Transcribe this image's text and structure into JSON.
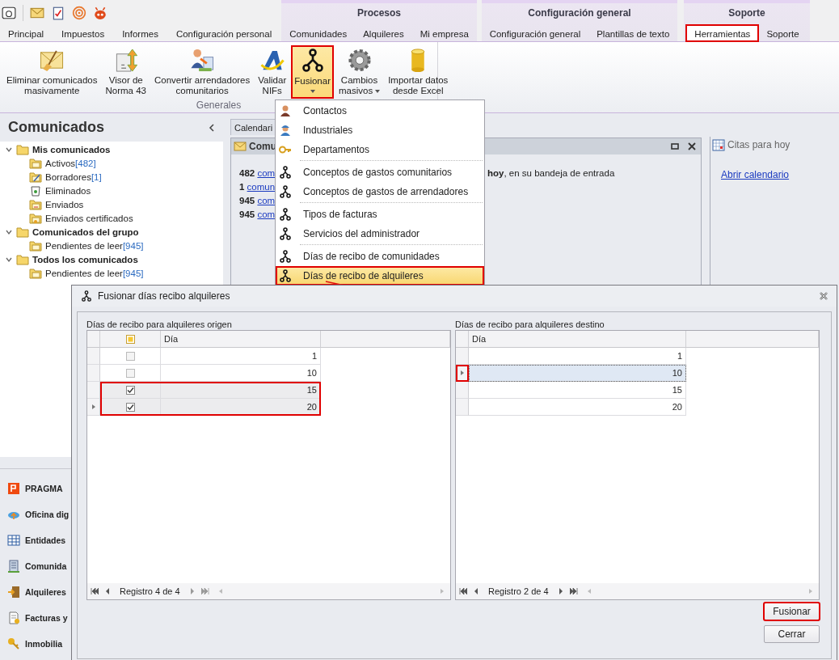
{
  "tabs": [
    {
      "label": "Principal",
      "selected": false,
      "highlighted": false
    },
    {
      "label": "Impuestos",
      "selected": false,
      "highlighted": false
    },
    {
      "label": "Informes",
      "selected": false,
      "highlighted": false
    },
    {
      "label": "Configuración personal",
      "selected": false,
      "highlighted": false
    }
  ],
  "tab_groups": [
    {
      "title": "Procesos",
      "tabs": [
        {
          "label": "Comunidades",
          "selected": false,
          "highlighted": false
        },
        {
          "label": "Alquileres",
          "selected": false,
          "highlighted": false
        },
        {
          "label": "Mi empresa",
          "selected": false,
          "highlighted": false
        }
      ]
    },
    {
      "title": "Configuración general",
      "tabs": [
        {
          "label": "Configuración general",
          "selected": false,
          "highlighted": false
        },
        {
          "label": "Plantillas de texto",
          "selected": false,
          "highlighted": false
        }
      ]
    },
    {
      "title": "Soporte",
      "tabs": [
        {
          "label": "Herramientas",
          "selected": true,
          "highlighted": true
        },
        {
          "label": "Soporte",
          "selected": false,
          "highlighted": false
        }
      ]
    }
  ],
  "ribbon": {
    "group_label": "Generales",
    "buttons": [
      {
        "lines": [
          "Eliminar comunicados",
          "masivamente"
        ],
        "dropdown": false,
        "highlighted": false
      },
      {
        "lines": [
          "Visor de",
          "Norma 43"
        ],
        "dropdown": false,
        "highlighted": false
      },
      {
        "lines": [
          "Convertir arrendadores",
          "comunitarios"
        ],
        "dropdown": false,
        "highlighted": false
      },
      {
        "lines": [
          "Validar",
          "NIFs"
        ],
        "dropdown": false,
        "highlighted": false
      },
      {
        "lines": [
          "Fusionar"
        ],
        "dropdown": true,
        "highlighted": true
      },
      {
        "lines": [
          "Cambios",
          "masivos"
        ],
        "dropdown": true,
        "highlighted": false
      },
      {
        "lines": [
          "Importar datos",
          "desde Excel"
        ],
        "dropdown": false,
        "highlighted": false
      }
    ]
  },
  "fusionar_menu": {
    "sections": [
      {
        "items": [
          {
            "label": "Contactos",
            "highlighted": false
          },
          {
            "label": "Industriales",
            "highlighted": false
          },
          {
            "label": "Departamentos",
            "highlighted": false
          }
        ]
      },
      {
        "items": [
          {
            "label": "Conceptos de gastos comunitarios",
            "highlighted": false
          },
          {
            "label": "Conceptos de gastos de arrendadores",
            "highlighted": false
          }
        ]
      },
      {
        "items": [
          {
            "label": "Tipos de facturas",
            "highlighted": false
          },
          {
            "label": "Servicios del administrador",
            "highlighted": false
          }
        ]
      },
      {
        "items": [
          {
            "label": "Días de recibo de comunidades",
            "highlighted": false
          },
          {
            "label": "Días de recibo de alquileres",
            "highlighted": true
          }
        ]
      }
    ]
  },
  "left_panel": {
    "title": "Comunicados",
    "tree": [
      {
        "label": "Mis comunicados",
        "expanded": true,
        "children": [
          {
            "label": "Activos",
            "count": "[482]"
          },
          {
            "label": "Borradores",
            "count": "[1]"
          },
          {
            "label": "Eliminados"
          },
          {
            "label": "Enviados"
          },
          {
            "label": "Enviados certificados"
          }
        ]
      },
      {
        "label": "Comunicados del grupo",
        "expanded": true,
        "children": [
          {
            "label": "Pendientes de leer",
            "count": "[945]"
          }
        ]
      },
      {
        "label": "Todos los comunicados",
        "expanded": true,
        "children": [
          {
            "label": "Pendientes de leer",
            "count": "[945]"
          }
        ]
      }
    ],
    "nav": [
      {
        "label": "PRAGMA"
      },
      {
        "label": "Oficina dig"
      },
      {
        "label": "Entidades"
      },
      {
        "label": "Comunida"
      },
      {
        "label": "Alquileres"
      },
      {
        "label": "Facturas y"
      },
      {
        "label": "Inmobilia"
      }
    ]
  },
  "center": {
    "tab": "Calendari",
    "panel_title": "Comu",
    "lines": [
      {
        "count": "482",
        "link": "com"
      },
      {
        "count": "1",
        "link": "comun"
      },
      {
        "count": "945",
        "link": "com"
      },
      {
        "count": "945",
        "link": "com"
      }
    ],
    "message_tail": "**hoy**, en su bandeja de entrada"
  },
  "right_panel": {
    "title": "Citas para hoy",
    "link": "Abrir calendario"
  },
  "dialog": {
    "title": "Fusionar días recibo alquileres",
    "origin": {
      "caption": "Días de recibo para alquileres origen",
      "header_indeterminate": true,
      "column": "Día",
      "navigator": "Registro 4 de 4",
      "rows": [
        {
          "value": "1",
          "checked": false,
          "current": false,
          "highlighted": false
        },
        {
          "value": "10",
          "checked": false,
          "current": false,
          "highlighted": false
        },
        {
          "value": "15",
          "checked": true,
          "current": false,
          "highlighted": true
        },
        {
          "value": "20",
          "checked": true,
          "current": true,
          "highlighted": true
        }
      ]
    },
    "target": {
      "caption": "Días de recibo para alquileres destino",
      "column": "Día",
      "navigator": "Registro 2 de 4",
      "rows": [
        {
          "value": "1",
          "selected": false,
          "current": false,
          "highlighted": false
        },
        {
          "value": "10",
          "selected": true,
          "current": true,
          "highlighted": true
        },
        {
          "value": "15",
          "selected": false,
          "current": false,
          "highlighted": false
        },
        {
          "value": "20",
          "selected": false,
          "current": false,
          "highlighted": false
        }
      ]
    },
    "buttons": [
      {
        "label": "Fusionar",
        "highlighted": true
      },
      {
        "label": "Cerrar",
        "highlighted": false
      }
    ]
  }
}
